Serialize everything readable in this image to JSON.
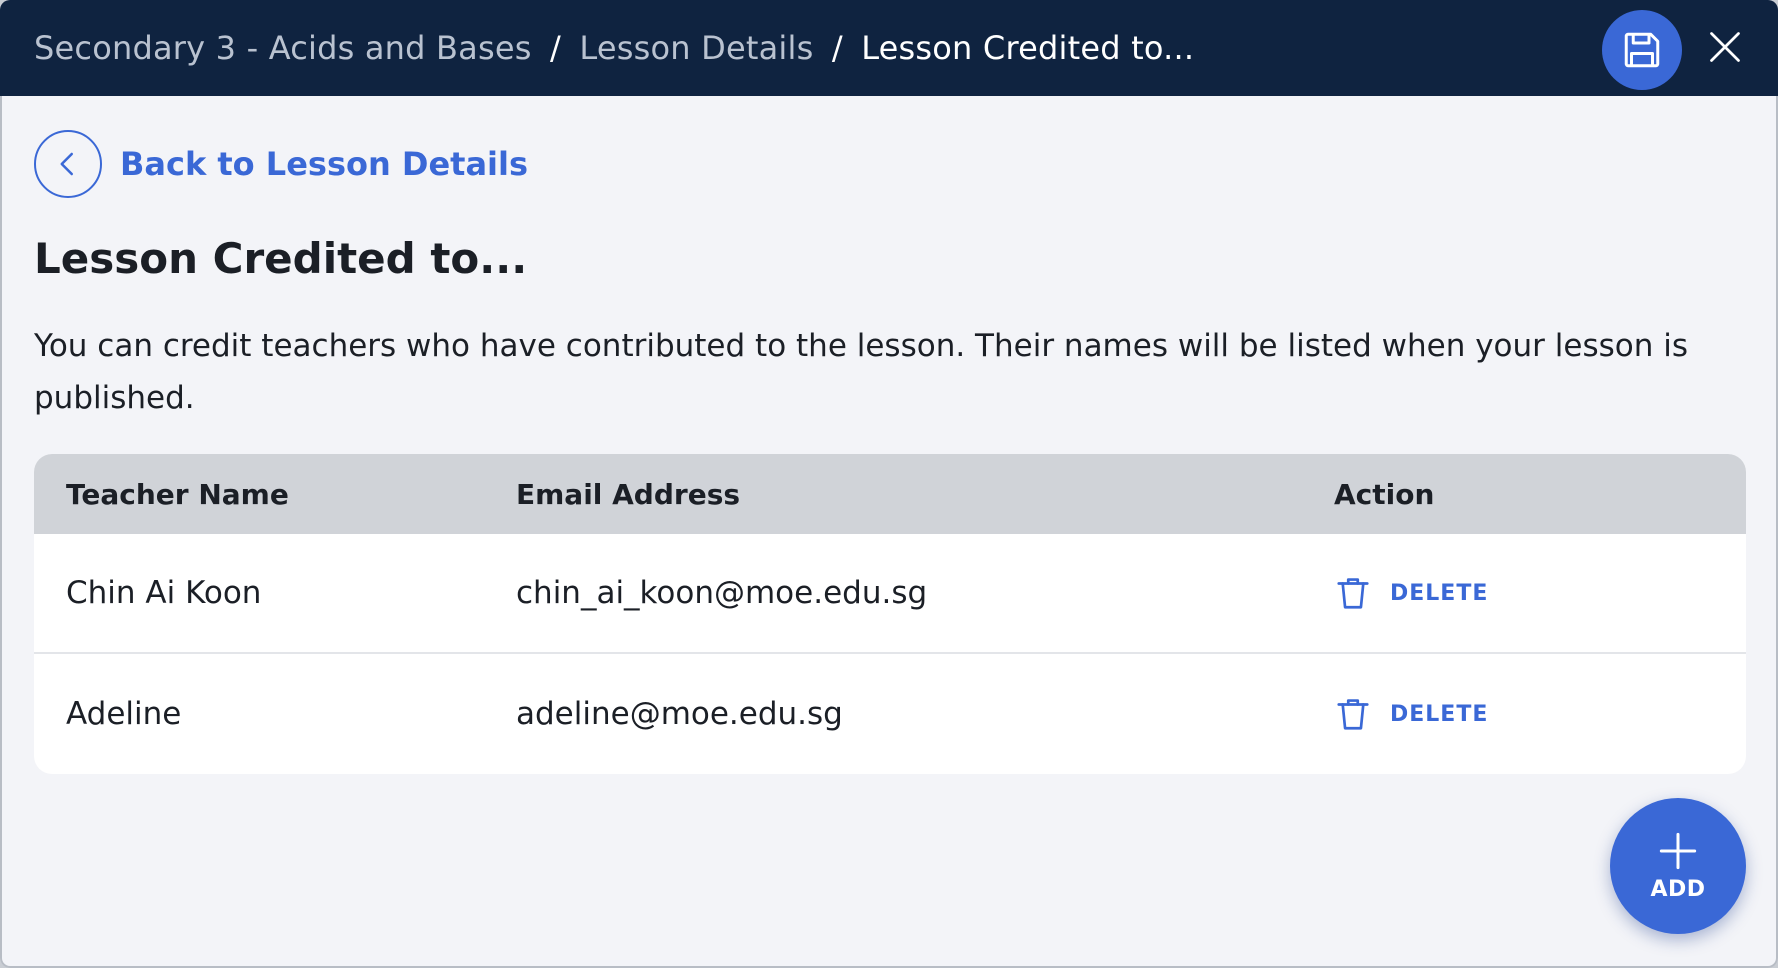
{
  "breadcrumb": {
    "items": [
      "Secondary 3 - Acids and Bases",
      "Lesson Details"
    ],
    "separator": "/",
    "current": "Lesson Credited to..."
  },
  "toolbar": {
    "save_icon": "save-icon",
    "close_icon": "close-icon"
  },
  "back": {
    "label": "Back to Lesson Details",
    "icon": "chevron-left-icon"
  },
  "page": {
    "title": "Lesson Credited to...",
    "description": "You can credit teachers who have contributed to the lesson. Their names will be listed when your lesson is published."
  },
  "table": {
    "columns": [
      "Teacher Name",
      "Email Address",
      "Action"
    ],
    "rows": [
      {
        "name": "Chin Ai Koon",
        "email": "chin_ai_koon@moe.edu.sg",
        "action": "DELETE"
      },
      {
        "name": "Adeline",
        "email": "adeline@moe.edu.sg",
        "action": "DELETE"
      }
    ]
  },
  "add_button": {
    "label": "ADD",
    "icon": "plus-icon"
  },
  "colors": {
    "header_bg": "#0f2340",
    "accent": "#3a68d6",
    "page_bg": "#f3f4f8",
    "table_header_bg": "#d0d3d8"
  }
}
